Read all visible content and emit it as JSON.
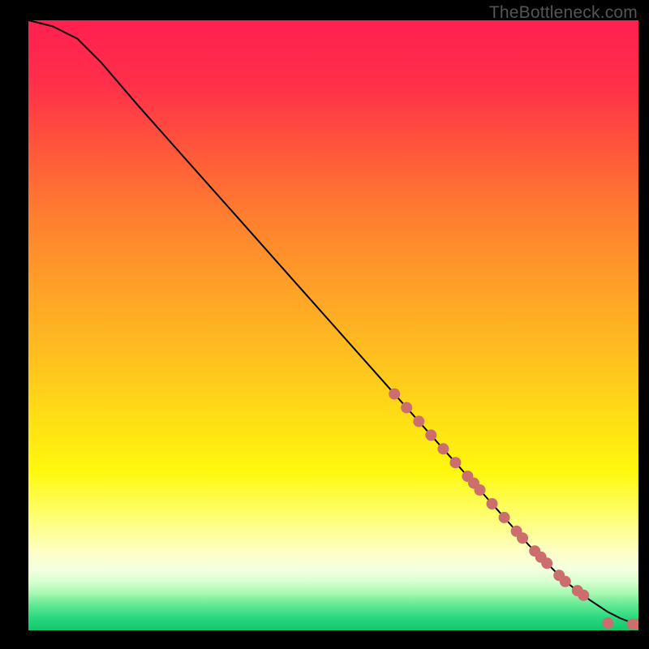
{
  "watermark": "TheBottleneck.com",
  "colors": {
    "dot": "#cc6e6e",
    "curve": "#000000",
    "frame_bg": "#000000"
  },
  "chart_data": {
    "type": "line",
    "title": "",
    "xlabel": "",
    "ylabel": "",
    "xlim": [
      0,
      100
    ],
    "ylim": [
      0,
      100
    ],
    "grid": false,
    "legend": false,
    "curve": {
      "x": [
        0,
        4,
        8,
        12,
        18,
        26,
        34,
        42,
        50,
        58,
        66,
        74,
        82,
        88,
        92,
        95,
        97,
        99,
        100
      ],
      "y": [
        100,
        99,
        97,
        93,
        86,
        77,
        68,
        59,
        50,
        41,
        32,
        23,
        14,
        8,
        5,
        3,
        2,
        1.2,
        1
      ]
    },
    "dots_on_curve_x": [
      60,
      62,
      64,
      66,
      68,
      70,
      72,
      73,
      74,
      76,
      78,
      80,
      81,
      83,
      84,
      85,
      87,
      88,
      90,
      91
    ],
    "flat_dots": [
      {
        "x": 95,
        "y": 1.2
      },
      {
        "x": 99,
        "y": 1.0
      },
      {
        "x": 100,
        "y": 1.0
      }
    ],
    "dot_radius": 7
  }
}
